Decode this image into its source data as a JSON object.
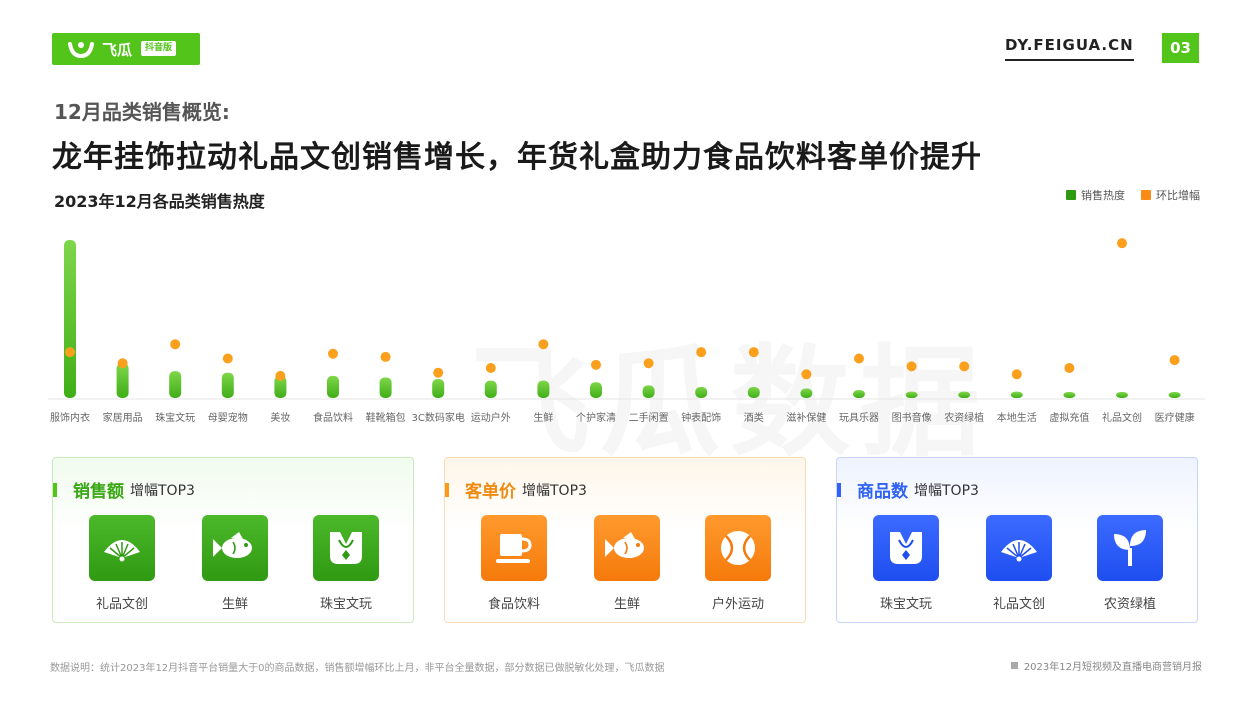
{
  "header": {
    "logo_text": "飞瓜",
    "logo_badge": "抖音版",
    "site": "DY.FEIGUA.CN",
    "page_no": "03"
  },
  "subtitle": "12月品类销售概览:",
  "headline": "龙年挂饰拉动礼品文创销售增长，年货礼盒助力食品饮料客单价提升",
  "watermark": "飞瓜数据",
  "colors": {
    "heat": "#52c41a",
    "growth": "#fa9a1c",
    "sales_accent": "#52c41a",
    "price_accent": "#fa9a1c",
    "items_accent": "#2f62f5"
  },
  "chart_data": {
    "type": "bar",
    "title": "2023年12月各品类销售热度",
    "categories": [
      "服饰内衣",
      "家居用品",
      "珠宝文玩",
      "母婴宠物",
      "美妆",
      "食品饮料",
      "鞋靴箱包",
      "3C数码家电",
      "运动户外",
      "生鲜",
      "个护家清",
      "二手闲置",
      "钟表配饰",
      "酒类",
      "滋补保健",
      "玩具乐器",
      "图书音像",
      "农资绿植",
      "本地生活",
      "虚拟充值",
      "礼品文创",
      "医疗健康"
    ],
    "series": [
      {
        "name": "销售热度",
        "type": "bar",
        "values": [
          100,
          22,
          17,
          16,
          14,
          14,
          13,
          12,
          11,
          11,
          10,
          8,
          7,
          7,
          6,
          5,
          4,
          4,
          4,
          3,
          3,
          3
        ]
      },
      {
        "name": "环比增幅",
        "type": "scatter",
        "values": [
          29,
          22,
          34,
          25,
          14,
          28,
          26,
          16,
          19,
          34,
          21,
          22,
          29,
          29,
          15,
          25,
          20,
          20,
          15,
          19,
          98,
          24
        ]
      }
    ],
    "legend_position": "top-right",
    "grid": false
  },
  "cards": [
    {
      "title": "销售额",
      "subtitle": "增幅TOP3",
      "items": [
        {
          "label": "礼品文创",
          "icon": "fan-icon"
        },
        {
          "label": "生鲜",
          "icon": "fish-icon"
        },
        {
          "label": "珠宝文玩",
          "icon": "necklace-icon"
        }
      ]
    },
    {
      "title": "客单价",
      "subtitle": "增幅TOP3",
      "items": [
        {
          "label": "食品饮料",
          "icon": "cup-icon"
        },
        {
          "label": "生鲜",
          "icon": "fish-icon"
        },
        {
          "label": "户外运动",
          "icon": "ball-icon"
        }
      ]
    },
    {
      "title": "商品数",
      "subtitle": "增幅TOP3",
      "items": [
        {
          "label": "珠宝文玩",
          "icon": "necklace-icon"
        },
        {
          "label": "礼品文创",
          "icon": "fan-icon"
        },
        {
          "label": "农资绿植",
          "icon": "sprout-icon"
        }
      ]
    }
  ],
  "footnote": "数据说明：统计2023年12月抖音平台销量大于0的商品数据，销售额增幅环比上月，非平台全量数据，部分数据已做脱敏化处理，飞瓜数据",
  "report_name": "2023年12月短视频及直播电商营销月报"
}
